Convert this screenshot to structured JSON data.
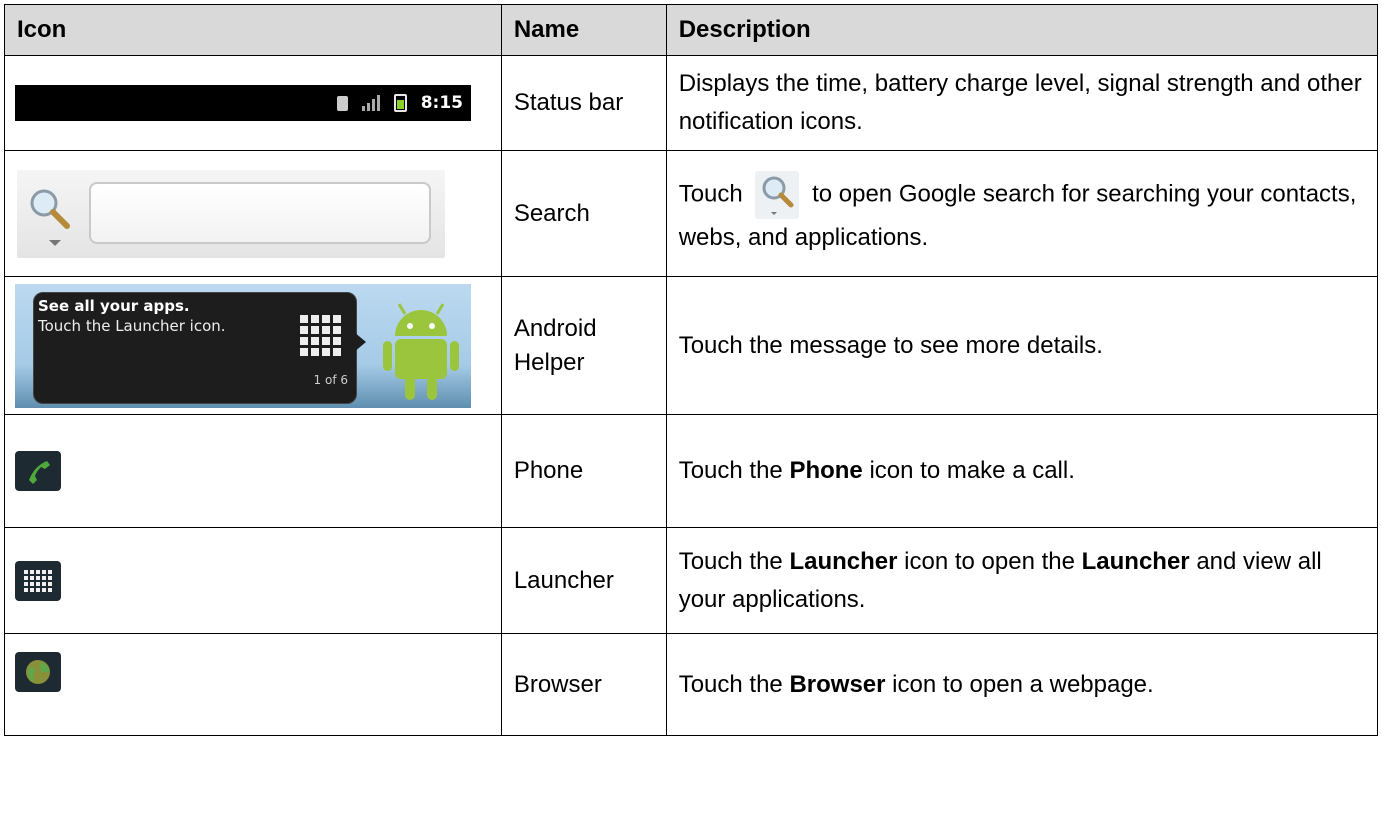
{
  "headers": [
    "Icon",
    "Name",
    "Description"
  ],
  "status_bar": {
    "time": "8:15"
  },
  "helper_bubble": {
    "title": "See all your apps.",
    "subtitle": "Touch the Launcher icon.",
    "count": "1 of 6"
  },
  "rows": [
    {
      "name": "Status bar",
      "desc": "Displays the time, battery charge level, signal strength and other notification icons."
    },
    {
      "name": "Search",
      "desc_before": "Touch",
      "desc_after": "to open Google search for searching your contacts, webs, and applications."
    },
    {
      "name": "Android Helper",
      "desc": "Touch the message to see more details."
    },
    {
      "name": "Phone",
      "desc_before": "Touch the",
      "bold": "Phone",
      "desc_after": "icon to make a call."
    },
    {
      "name": "Launcher",
      "desc_before": "Touch the",
      "bold": "Launcher",
      "desc_middle": "icon to open the",
      "bold2": "Launcher",
      "desc_after": "and view all your applications."
    },
    {
      "name": "Browser",
      "desc_before": "Touch the",
      "bold": "Browser",
      "desc_after": "icon to open a webpage."
    }
  ],
  "colors": {
    "header_bg": "#d9d9d9",
    "statusbar_bg": "#000000",
    "battery": "#8ad02a",
    "android_green": "#9bc53d",
    "app_icon_bg": "#1e2a31"
  },
  "icons": [
    "status-bar-image",
    "search-widget-image",
    "android-helper-image",
    "phone-icon",
    "launcher-icon",
    "browser-icon",
    "magnifier-icon"
  ]
}
